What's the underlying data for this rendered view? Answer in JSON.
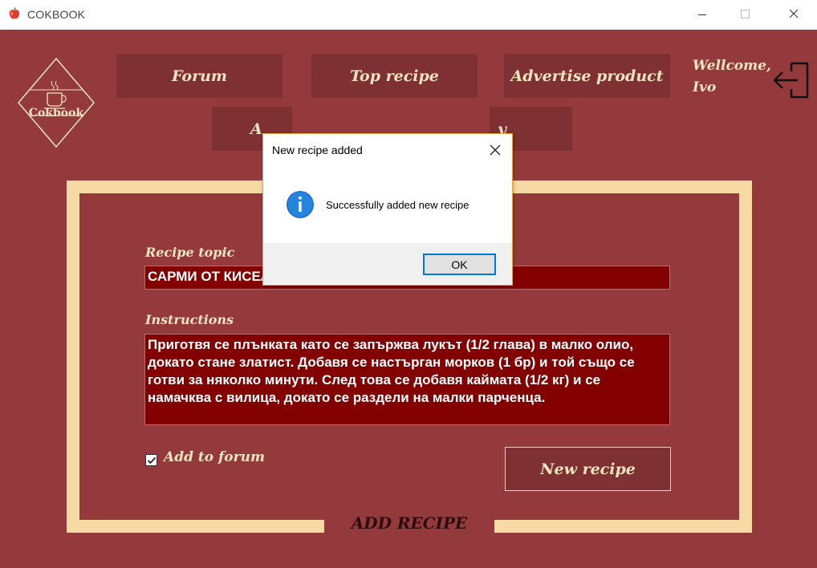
{
  "window": {
    "title": "COKBOOK",
    "icon": "apple-icon",
    "controls": [
      "minimize-icon",
      "maximize-icon",
      "close-icon"
    ]
  },
  "logo": {
    "text": "Cokbook",
    "icon": "coffee-cup-icon"
  },
  "nav": {
    "forum": "Forum",
    "top_recipe": "Top recipe",
    "advertise_product": "Advertise product",
    "row2_left_visible": "A",
    "row2_right_visible": "y"
  },
  "welcome": {
    "line1": "Wellcome,",
    "line2": "Ivo"
  },
  "form": {
    "topic_label": "Recipe topic",
    "topic_value": "САРМИ ОТ КИСЕЛО ЗЕЛЕ С КАЙМА И ОРИЗ",
    "instructions_label": "Instructions",
    "instructions_value": "Приготвя се плънката като се запържва лукът (1/2 глава) в малко олио, докато стане златист. Добавя се настърган морков (1 бр) и той също се готви за няколко минути. След това се добавя каймата (1/2 кг) и се намачква с вилица, докато се раздели на малки парченца.",
    "add_to_forum_label": "Add to forum",
    "add_to_forum_checked": true,
    "submit_label": "New recipe",
    "section_caption": "ADD RECIPE"
  },
  "dialog": {
    "title": "New recipe added",
    "message": "Successfully added new recipe",
    "ok_label": "OK",
    "icon": "info-icon"
  },
  "colors": {
    "background": "#943a3c",
    "button": "#7e3032",
    "input": "#820000",
    "frame": "#f7d9a3",
    "accent_text": "#f4e3c1",
    "dialog_border": "#e8a030",
    "ok_focus": "#0078d7"
  }
}
